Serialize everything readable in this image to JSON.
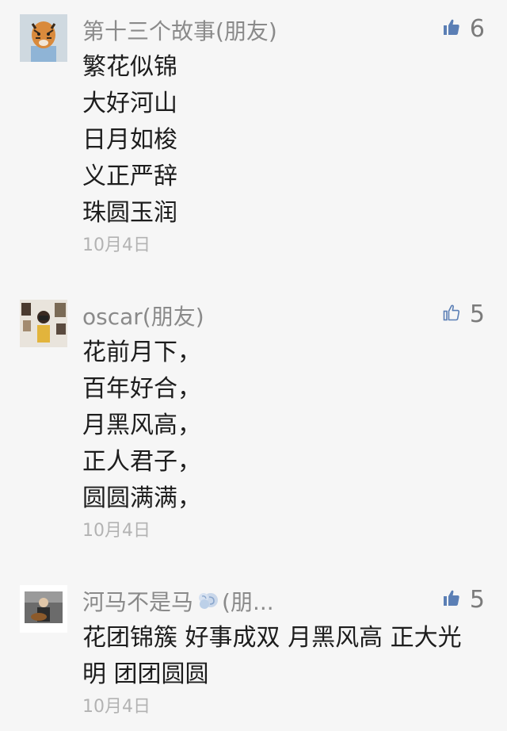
{
  "comments": [
    {
      "name": "第十三个故事(朋友)",
      "likes": "6",
      "liked": true,
      "lines": [
        "繁花似锦",
        "大好河山",
        "日月如梭",
        "义正严辞",
        "珠圆玉润"
      ],
      "date": "10月4日"
    },
    {
      "name": "oscar(朋友)",
      "likes": "5",
      "liked": false,
      "lines": [
        "花前月下，",
        "百年好合，",
        "月黑风高，",
        "正人君子，",
        "圆圆满满，"
      ],
      "date": "10月4日"
    },
    {
      "name_prefix": "河马不是马",
      "name_suffix": "(朋...",
      "likes": "5",
      "liked": true,
      "lines": [
        "花团锦簇 好事成双 月黑风高 正大光明 团团圆圆"
      ],
      "date": "10月4日"
    }
  ],
  "icons": {
    "liked": "thumbs-up-filled-icon",
    "not_liked": "thumbs-up-outline-icon",
    "name_emoji": "dashing-away-emoji-icon"
  },
  "colors": {
    "like_icon": "#5b7fb5",
    "name": "#8a8a8a",
    "date": "#b3b3b3",
    "content": "#1d1d1d",
    "background": "#f6f6f6"
  }
}
